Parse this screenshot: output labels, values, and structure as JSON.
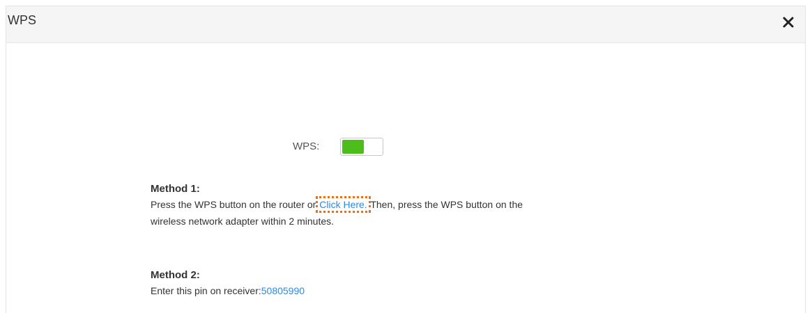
{
  "dialog": {
    "title": "WPS",
    "close_icon": "close-icon"
  },
  "wps_toggle": {
    "label": "WPS:",
    "state": "on",
    "on_color": "#4dbd1c"
  },
  "method1": {
    "title": "Method 1:",
    "text_before": "Press the WPS button on the router or ",
    "link_label": "Click Here.",
    "text_after": " Then, press the WPS button on the",
    "text_line2": "wireless network adapter within 2 minutes."
  },
  "method2": {
    "title": "Method 2:",
    "text": "Enter this pin on receiver:",
    "pin": "50805990"
  },
  "colors": {
    "link": "#2b8be3",
    "highlight_outline": "#e7701d"
  }
}
